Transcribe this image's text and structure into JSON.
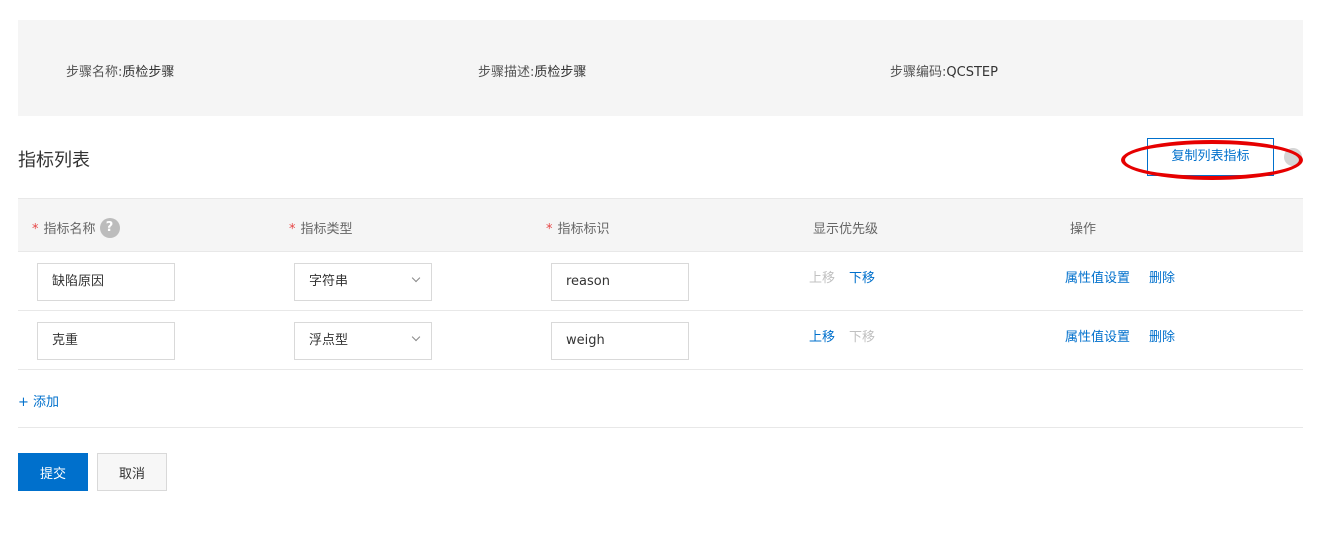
{
  "step_info": {
    "name_label": "步骤名称:",
    "name_value": "质检步骤",
    "desc_label": "步骤描述:",
    "desc_value": "质检步骤",
    "code_label": "步骤编码:",
    "code_value": "QCSTEP"
  },
  "section": {
    "title": "指标列表",
    "copy_button": "复制列表指标"
  },
  "table": {
    "required_mark": "*",
    "help_icon_text": "?",
    "headers": {
      "name": "指标名称",
      "type": "指标类型",
      "identifier": "指标标识",
      "priority": "显示优先级",
      "actions": "操作"
    },
    "rows": [
      {
        "name": "缺陷原因",
        "type": "字符串",
        "identifier": "reason",
        "move_up": "上移",
        "move_down": "下移",
        "attr_settings": "属性值设置",
        "delete": "删除"
      },
      {
        "name": "克重",
        "type": "浮点型",
        "identifier": "weigh",
        "move_up": "上移",
        "move_down": "下移",
        "attr_settings": "属性值设置",
        "delete": "删除"
      }
    ]
  },
  "add_link": "+ 添加",
  "footer": {
    "submit": "提交",
    "cancel": "取消"
  },
  "colors": {
    "primary": "#0070cc",
    "annotation": "#e60000",
    "panel_bg": "#f5f5f5"
  }
}
